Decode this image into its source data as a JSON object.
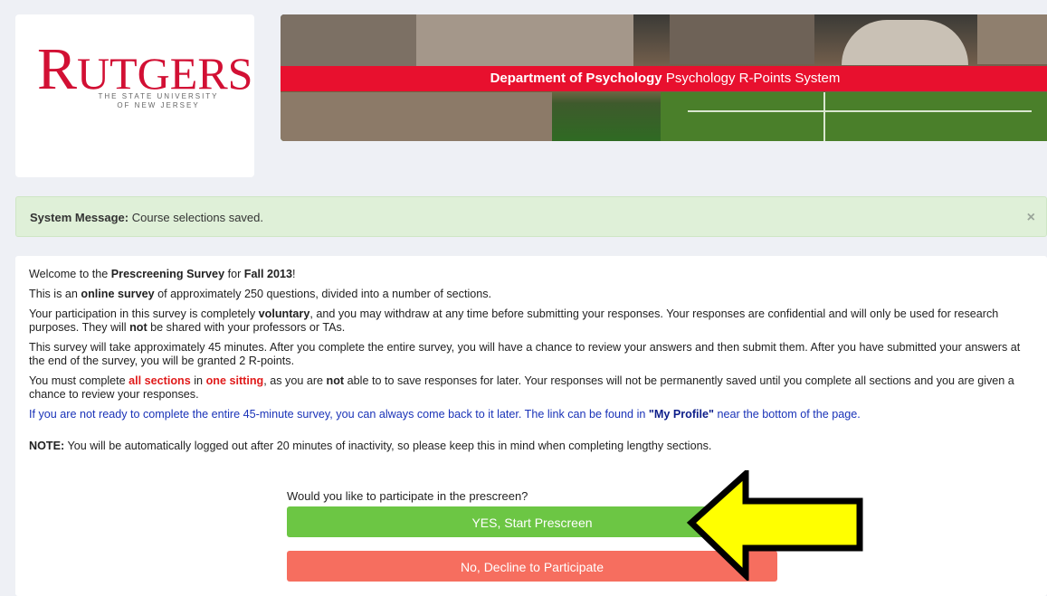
{
  "logo": {
    "word_first": "R",
    "word_rest": "UTGERS",
    "sub_line1": "THE STATE UNIVERSITY",
    "sub_line2": "OF NEW JERSEY"
  },
  "banner": {
    "dept": "Department of Psychology",
    "system": "Psychology R-Points System"
  },
  "system_message": {
    "label": "System Message:",
    "text": "Course selections saved.",
    "close": "×"
  },
  "content": {
    "p1_a": "Welcome to the ",
    "p1_b": "Prescreening Survey",
    "p1_c": " for ",
    "p1_d": "Fall 2013",
    "p1_e": "!",
    "p2_a": "This is an ",
    "p2_b": "online survey",
    "p2_c": " of approximately 250 questions, divided into a number of sections.",
    "p3_a": "Your participation in this survey is completely ",
    "p3_b": "voluntary",
    "p3_c": ", and you may withdraw at any time before submitting your responses. Your responses are confidential and will only be used for research purposes. They will ",
    "p3_d": "not",
    "p3_e": " be shared with your professors or TAs.",
    "p4": "This survey will take approximately 45 minutes. After you complete the entire survey, you will have a chance to review your answers and then submit them. After you have submitted your answers at the end of the survey, you will be granted 2 R-points.",
    "p5_a": "You must complete ",
    "p5_b": "all sections",
    "p5_c": " in ",
    "p5_d": "one sitting",
    "p5_e": ", as you are ",
    "p5_f": "not",
    "p5_g": " able to to save responses for later. Your responses will not be permanently saved until you complete all sections and you are given a chance to review your responses.",
    "p6_a": "If you are not ready to complete the entire 45-minute survey, you can always come back to it later. The link can be found in ",
    "p6_b": "\"My Profile\"",
    "p6_c": " near the bottom of the page.",
    "note_label": "NOTE:",
    "note_text": " You will be automatically logged out after 20 minutes of inactivity, so please keep this in mind when completing lengthy sections.",
    "prompt": "Would you like to participate in the prescreen?",
    "yes_button": "YES, Start Prescreen",
    "no_button": "No, Decline to Participate"
  },
  "colors": {
    "rutgers_red": "#d21034",
    "banner_strip": "#e8102e",
    "yes_green": "#6cc644",
    "no_red": "#f66e5f",
    "arrow_yellow": "#ffff00",
    "message_bg": "#dff0d8"
  },
  "icons": {
    "close": "close-icon",
    "arrow": "arrow-left-icon"
  }
}
